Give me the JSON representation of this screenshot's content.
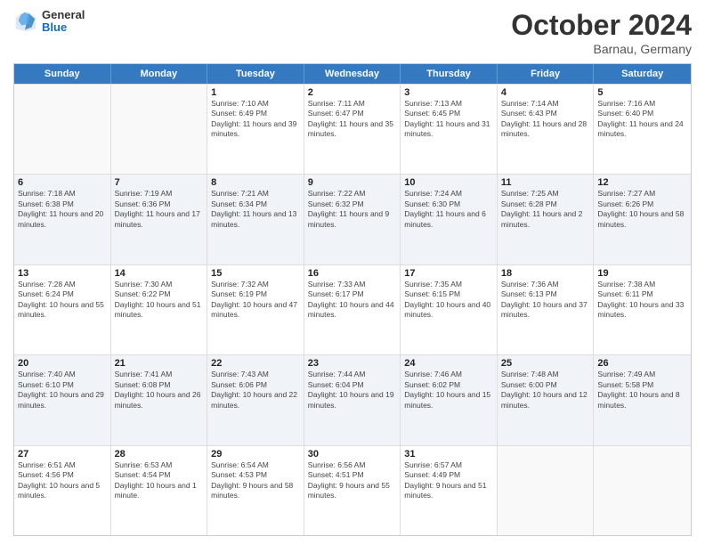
{
  "header": {
    "logo": {
      "general": "General",
      "blue": "Blue"
    },
    "title": "October 2024",
    "subtitle": "Barnau, Germany"
  },
  "calendar": {
    "days_of_week": [
      "Sunday",
      "Monday",
      "Tuesday",
      "Wednesday",
      "Thursday",
      "Friday",
      "Saturday"
    ],
    "weeks": [
      [
        {
          "day": "",
          "empty": true
        },
        {
          "day": "",
          "empty": true
        },
        {
          "day": "1",
          "sunrise": "Sunrise: 7:10 AM",
          "sunset": "Sunset: 6:49 PM",
          "daylight": "Daylight: 11 hours and 39 minutes."
        },
        {
          "day": "2",
          "sunrise": "Sunrise: 7:11 AM",
          "sunset": "Sunset: 6:47 PM",
          "daylight": "Daylight: 11 hours and 35 minutes."
        },
        {
          "day": "3",
          "sunrise": "Sunrise: 7:13 AM",
          "sunset": "Sunset: 6:45 PM",
          "daylight": "Daylight: 11 hours and 31 minutes."
        },
        {
          "day": "4",
          "sunrise": "Sunrise: 7:14 AM",
          "sunset": "Sunset: 6:43 PM",
          "daylight": "Daylight: 11 hours and 28 minutes."
        },
        {
          "day": "5",
          "sunrise": "Sunrise: 7:16 AM",
          "sunset": "Sunset: 6:40 PM",
          "daylight": "Daylight: 11 hours and 24 minutes."
        }
      ],
      [
        {
          "day": "6",
          "sunrise": "Sunrise: 7:18 AM",
          "sunset": "Sunset: 6:38 PM",
          "daylight": "Daylight: 11 hours and 20 minutes."
        },
        {
          "day": "7",
          "sunrise": "Sunrise: 7:19 AM",
          "sunset": "Sunset: 6:36 PM",
          "daylight": "Daylight: 11 hours and 17 minutes."
        },
        {
          "day": "8",
          "sunrise": "Sunrise: 7:21 AM",
          "sunset": "Sunset: 6:34 PM",
          "daylight": "Daylight: 11 hours and 13 minutes."
        },
        {
          "day": "9",
          "sunrise": "Sunrise: 7:22 AM",
          "sunset": "Sunset: 6:32 PM",
          "daylight": "Daylight: 11 hours and 9 minutes."
        },
        {
          "day": "10",
          "sunrise": "Sunrise: 7:24 AM",
          "sunset": "Sunset: 6:30 PM",
          "daylight": "Daylight: 11 hours and 6 minutes."
        },
        {
          "day": "11",
          "sunrise": "Sunrise: 7:25 AM",
          "sunset": "Sunset: 6:28 PM",
          "daylight": "Daylight: 11 hours and 2 minutes."
        },
        {
          "day": "12",
          "sunrise": "Sunrise: 7:27 AM",
          "sunset": "Sunset: 6:26 PM",
          "daylight": "Daylight: 10 hours and 58 minutes."
        }
      ],
      [
        {
          "day": "13",
          "sunrise": "Sunrise: 7:28 AM",
          "sunset": "Sunset: 6:24 PM",
          "daylight": "Daylight: 10 hours and 55 minutes."
        },
        {
          "day": "14",
          "sunrise": "Sunrise: 7:30 AM",
          "sunset": "Sunset: 6:22 PM",
          "daylight": "Daylight: 10 hours and 51 minutes."
        },
        {
          "day": "15",
          "sunrise": "Sunrise: 7:32 AM",
          "sunset": "Sunset: 6:19 PM",
          "daylight": "Daylight: 10 hours and 47 minutes."
        },
        {
          "day": "16",
          "sunrise": "Sunrise: 7:33 AM",
          "sunset": "Sunset: 6:17 PM",
          "daylight": "Daylight: 10 hours and 44 minutes."
        },
        {
          "day": "17",
          "sunrise": "Sunrise: 7:35 AM",
          "sunset": "Sunset: 6:15 PM",
          "daylight": "Daylight: 10 hours and 40 minutes."
        },
        {
          "day": "18",
          "sunrise": "Sunrise: 7:36 AM",
          "sunset": "Sunset: 6:13 PM",
          "daylight": "Daylight: 10 hours and 37 minutes."
        },
        {
          "day": "19",
          "sunrise": "Sunrise: 7:38 AM",
          "sunset": "Sunset: 6:11 PM",
          "daylight": "Daylight: 10 hours and 33 minutes."
        }
      ],
      [
        {
          "day": "20",
          "sunrise": "Sunrise: 7:40 AM",
          "sunset": "Sunset: 6:10 PM",
          "daylight": "Daylight: 10 hours and 29 minutes."
        },
        {
          "day": "21",
          "sunrise": "Sunrise: 7:41 AM",
          "sunset": "Sunset: 6:08 PM",
          "daylight": "Daylight: 10 hours and 26 minutes."
        },
        {
          "day": "22",
          "sunrise": "Sunrise: 7:43 AM",
          "sunset": "Sunset: 6:06 PM",
          "daylight": "Daylight: 10 hours and 22 minutes."
        },
        {
          "day": "23",
          "sunrise": "Sunrise: 7:44 AM",
          "sunset": "Sunset: 6:04 PM",
          "daylight": "Daylight: 10 hours and 19 minutes."
        },
        {
          "day": "24",
          "sunrise": "Sunrise: 7:46 AM",
          "sunset": "Sunset: 6:02 PM",
          "daylight": "Daylight: 10 hours and 15 minutes."
        },
        {
          "day": "25",
          "sunrise": "Sunrise: 7:48 AM",
          "sunset": "Sunset: 6:00 PM",
          "daylight": "Daylight: 10 hours and 12 minutes."
        },
        {
          "day": "26",
          "sunrise": "Sunrise: 7:49 AM",
          "sunset": "Sunset: 5:58 PM",
          "daylight": "Daylight: 10 hours and 8 minutes."
        }
      ],
      [
        {
          "day": "27",
          "sunrise": "Sunrise: 6:51 AM",
          "sunset": "Sunset: 4:56 PM",
          "daylight": "Daylight: 10 hours and 5 minutes."
        },
        {
          "day": "28",
          "sunrise": "Sunrise: 6:53 AM",
          "sunset": "Sunset: 4:54 PM",
          "daylight": "Daylight: 10 hours and 1 minute."
        },
        {
          "day": "29",
          "sunrise": "Sunrise: 6:54 AM",
          "sunset": "Sunset: 4:53 PM",
          "daylight": "Daylight: 9 hours and 58 minutes."
        },
        {
          "day": "30",
          "sunrise": "Sunrise: 6:56 AM",
          "sunset": "Sunset: 4:51 PM",
          "daylight": "Daylight: 9 hours and 55 minutes."
        },
        {
          "day": "31",
          "sunrise": "Sunrise: 6:57 AM",
          "sunset": "Sunset: 4:49 PM",
          "daylight": "Daylight: 9 hours and 51 minutes."
        },
        {
          "day": "",
          "empty": true
        },
        {
          "day": "",
          "empty": true
        }
      ]
    ]
  }
}
